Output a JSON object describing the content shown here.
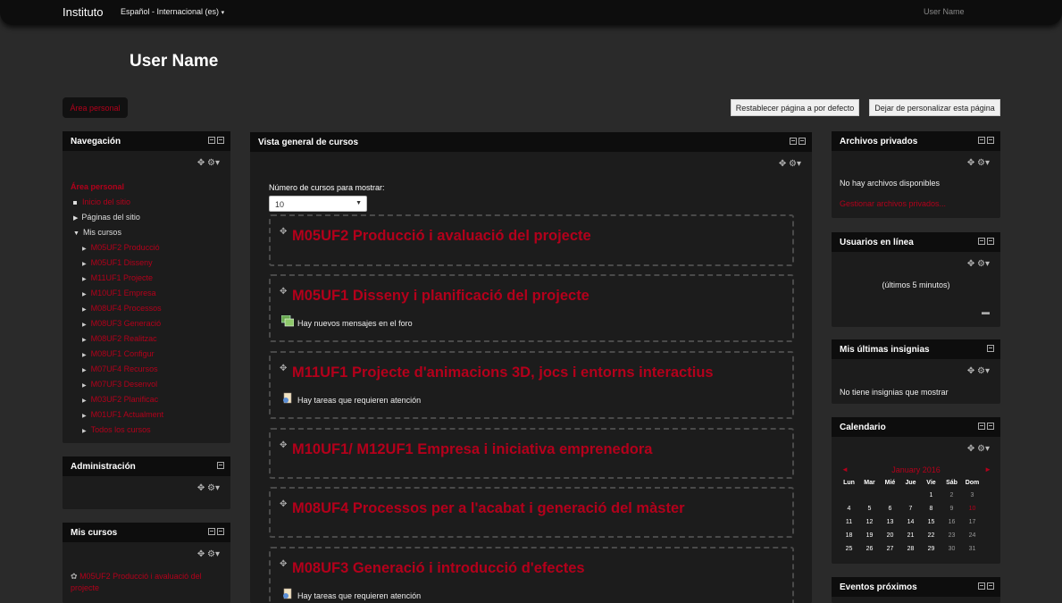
{
  "topbar": {
    "brand": "Instituto",
    "language": "Español - Internacional (es)",
    "language_caret": "▾",
    "user": "User Name"
  },
  "page": {
    "title": "User Name",
    "red_button": "Área personal",
    "reset_button": "Restablecer página a por defecto",
    "stop_customize_button": "Dejar de personalizar esta página"
  },
  "navigation": {
    "title": "Navegación",
    "home": "Área personal",
    "site_home": "Inicio del sitio",
    "site_pages": "Páginas del sitio",
    "my_courses": "Mis cursos",
    "courses": [
      "M05UF2 Producció",
      "M05UF1 Disseny",
      "M11UF1 Projecte",
      "M10UF1 Empresa",
      "M08UF4 Processos",
      "M08UF3 Generació",
      "M08UF2 Realitzac",
      "M08UF1 Configur",
      "M07UF4 Recursos",
      "M07UF3 Desenvol",
      "M03UF2 Planificac",
      "M01UF1 Actualment"
    ],
    "more": "Todos los cursos"
  },
  "administration": {
    "title": "Administración"
  },
  "my_courses_block": {
    "title": "Mis cursos",
    "first_item": "M05UF2 Producció i avaluació del projecte"
  },
  "overview": {
    "title": "Vista general de cursos",
    "show_label": "Número de cursos para mostrar:",
    "show_value": "10",
    "courses": [
      {
        "title": "M05UF2 Producció i avaluació del projecte",
        "message": "",
        "icon": ""
      },
      {
        "title": "M05UF1 Disseny i planificació del projecte",
        "message": "Hay nuevos mensajes en el foro",
        "icon": "forum-icon"
      },
      {
        "title": "M11UF1 Projecte d'animacions 3D, jocs i entorns interactius",
        "message": "Hay tareas que requieren atención",
        "icon": "assignment-icon"
      },
      {
        "title": "M10UF1/ M12UF1 Empresa i iniciativa emprenedora",
        "message": "",
        "icon": ""
      },
      {
        "title": "M08UF4 Processos per a l'acabat i generació del màster",
        "message": "",
        "icon": ""
      },
      {
        "title": "M08UF3 Generació i introducció d'efectes",
        "message": "Hay tareas que requieren atención",
        "icon": "assignment-icon"
      }
    ]
  },
  "private_files": {
    "title": "Archivos privados",
    "empty": "No hay archivos disponibles",
    "manage": "Gestionar archivos privados..."
  },
  "online_users": {
    "title": "Usuarios en línea",
    "period": "(últimos 5 minutos)"
  },
  "badges": {
    "title": "Mis últimas insignias",
    "empty": "No tiene insignias que mostrar"
  },
  "calendar": {
    "title": "Calendario",
    "month": "January 2016",
    "prev": "◄",
    "next": "►",
    "days": [
      "Lun",
      "Mar",
      "Mié",
      "Jue",
      "Vie",
      "Sáb",
      "Dom"
    ],
    "weeks": [
      [
        "",
        "",
        "",
        "",
        "1",
        "2",
        "3"
      ],
      [
        "4",
        "5",
        "6",
        "7",
        "8",
        "9",
        "10"
      ],
      [
        "11",
        "12",
        "13",
        "14",
        "15",
        "16",
        "17"
      ],
      [
        "18",
        "19",
        "20",
        "21",
        "22",
        "23",
        "24"
      ],
      [
        "25",
        "26",
        "27",
        "28",
        "29",
        "30",
        "31"
      ]
    ]
  },
  "events": {
    "title": "Eventos próximos"
  },
  "colors": {
    "accent": "#b3001b",
    "header": "#0d0d0d",
    "block": "#1c1c1c",
    "page": "#2a2a2a"
  }
}
